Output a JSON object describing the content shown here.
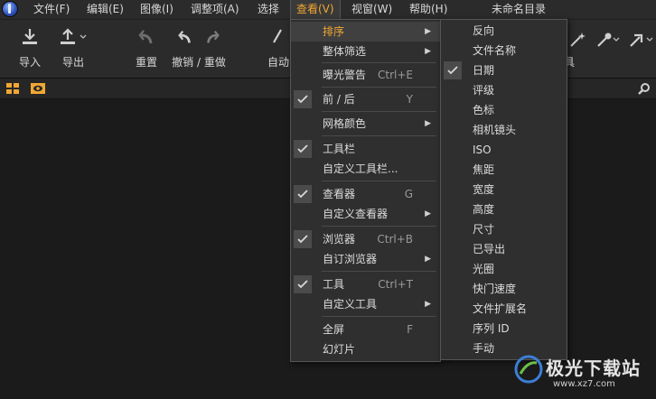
{
  "menubar": {
    "items": [
      "文件(F)",
      "编辑(E)",
      "图像(I)",
      "调整项(A)",
      "选择",
      "查看(V)",
      "视窗(W)",
      "帮助(H)"
    ],
    "doc_title": "未命名目录"
  },
  "toolbar": {
    "import": "导入",
    "export": "导出",
    "reset": "重置",
    "undo_redo": "撤销 / 重做",
    "auto": "自动"
  },
  "view_menu": {
    "items": [
      {
        "label": "排序"
      },
      {
        "label": "整体筛选"
      },
      {
        "label": "曝光警告",
        "shortcut": "Ctrl+E"
      },
      {
        "label": "前 / 后",
        "shortcut": "Y"
      },
      {
        "label": "网格颜色"
      },
      {
        "label": "工具栏"
      },
      {
        "label": "自定义工具栏..."
      },
      {
        "label": "查看器",
        "shortcut": "G"
      },
      {
        "label": "自定义查看器"
      },
      {
        "label": "浏览器",
        "shortcut": "Ctrl+B"
      },
      {
        "label": "自订浏览器"
      },
      {
        "label": "工具",
        "shortcut": "Ctrl+T"
      },
      {
        "label": "自定义工具"
      },
      {
        "label": "全屏",
        "shortcut": "F"
      },
      {
        "label": "幻灯片"
      }
    ]
  },
  "sort_menu": {
    "items": [
      "反向",
      "文件名称",
      "日期",
      "评级",
      "色标",
      "相机镜头",
      "ISO",
      "焦距",
      "宽度",
      "高度",
      "尺寸",
      "已导出",
      "光圈",
      "快门速度",
      "文件扩展名",
      "序列 ID",
      "手动"
    ]
  },
  "partial": {
    "right_label": "具"
  },
  "watermark": {
    "name": "极光下载站",
    "url": "www.xz7.com"
  },
  "colors": {
    "accent": "#f0a733",
    "menu_bg": "#2f2f2f",
    "toolbar_bg": "#2b2b2b"
  }
}
